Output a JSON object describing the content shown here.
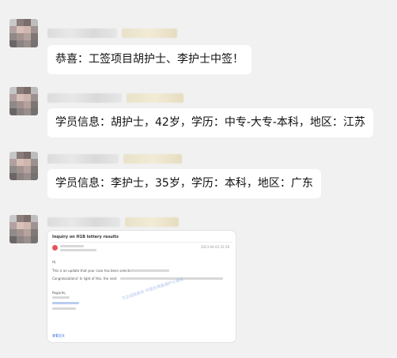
{
  "messages": [
    {
      "text": "恭喜：工签项目胡护士、李护士中签！"
    },
    {
      "text": "学员信息：胡护士，42岁，学历：中专-大专-本科，地区：江苏"
    },
    {
      "text": "学员信息：李护士，35岁，学历：本科，地区：广东"
    }
  ],
  "email_card": {
    "subject": "Inquiry on H1B lottery results",
    "greeting": "Hi,",
    "body_line1": "This is an update that your case has been selected",
    "body_line2": "Congratulations! In light of this, the next",
    "regards": "Regards,",
    "watermark": "万企成就路名·中国全境直通护士通道",
    "link_text": "查看全文"
  }
}
